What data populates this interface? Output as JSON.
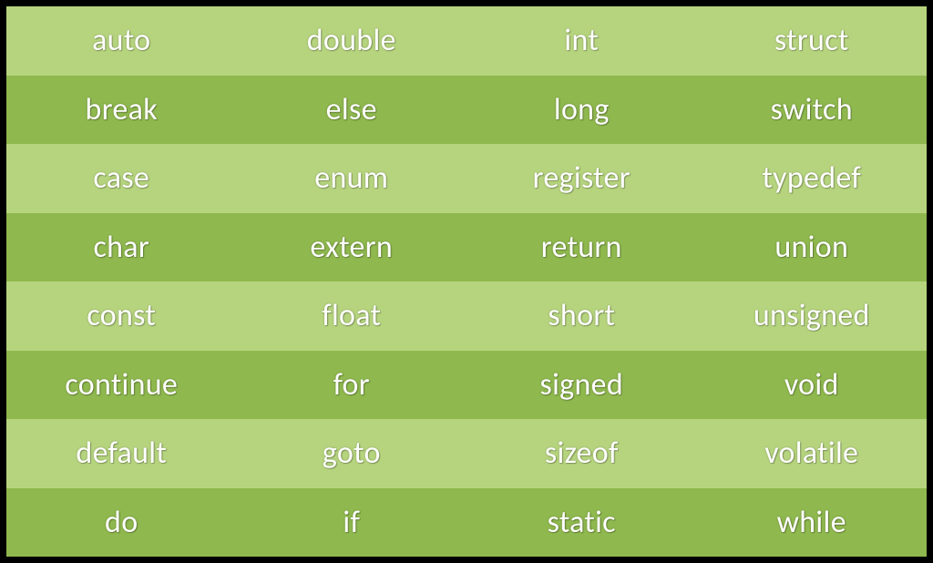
{
  "colors": {
    "row_light": "#b6d47e",
    "row_dark": "#8fb84e",
    "text": "#ffffff",
    "border": "#000000"
  },
  "rows": [
    {
      "cells": [
        "auto",
        "double",
        "int",
        "struct"
      ]
    },
    {
      "cells": [
        "break",
        "else",
        "long",
        "switch"
      ]
    },
    {
      "cells": [
        "case",
        "enum",
        "register",
        "typedef"
      ]
    },
    {
      "cells": [
        "char",
        "extern",
        "return",
        "union"
      ]
    },
    {
      "cells": [
        "const",
        "float",
        "short",
        "unsigned"
      ]
    },
    {
      "cells": [
        "continue",
        "for",
        "signed",
        "void"
      ]
    },
    {
      "cells": [
        "default",
        "goto",
        "sizeof",
        "volatile"
      ]
    },
    {
      "cells": [
        "do",
        "if",
        "static",
        "while"
      ]
    }
  ]
}
